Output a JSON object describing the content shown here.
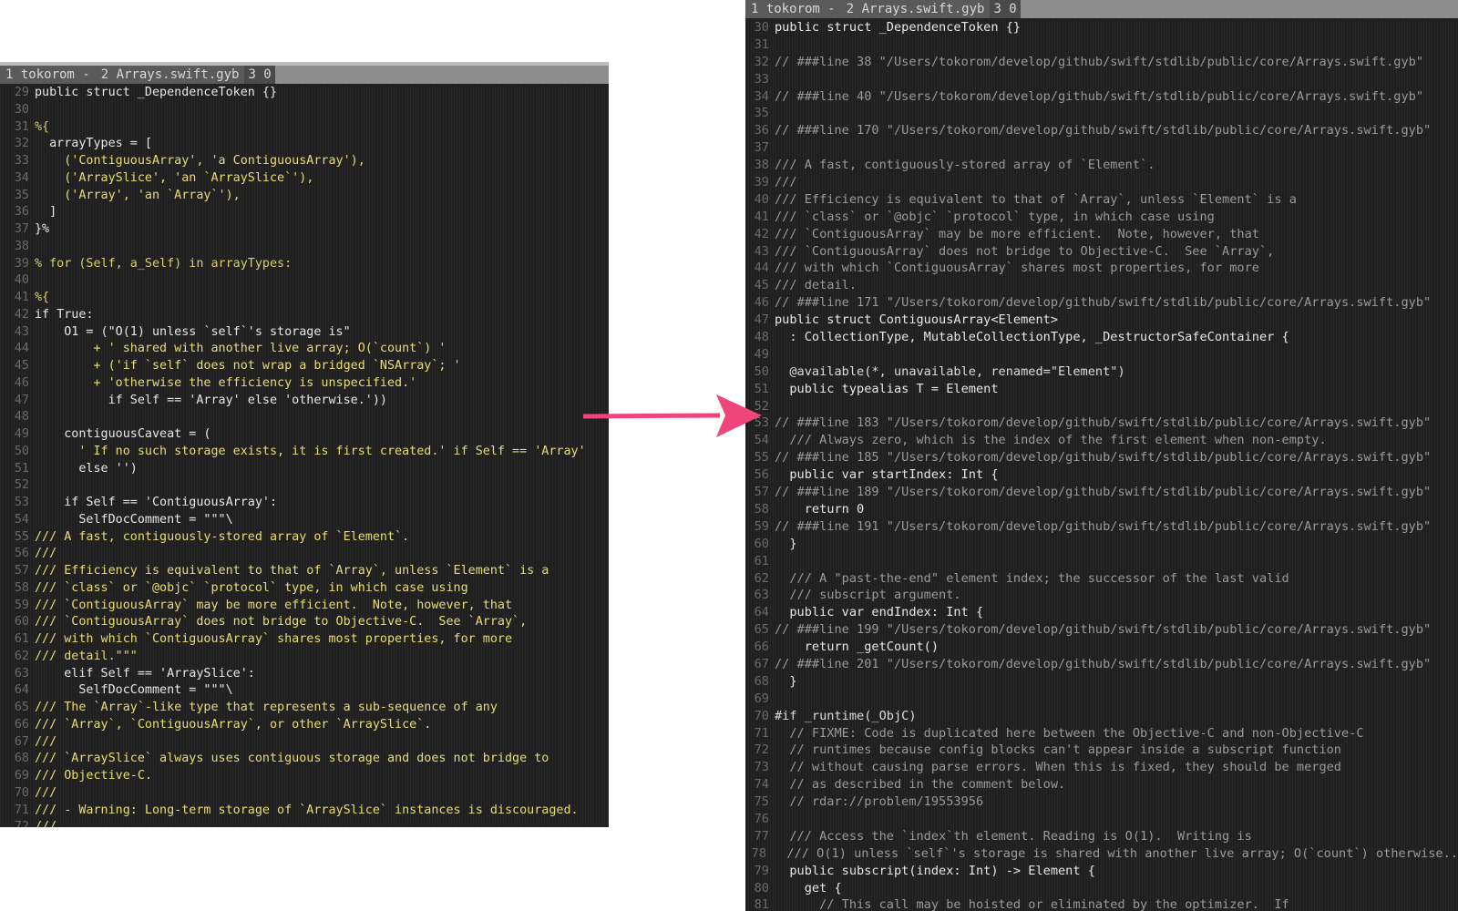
{
  "left_pane": {
    "tabs": [
      "1 tokorom -",
      "2 Arrays.swift.gyb",
      "3 0"
    ],
    "lines": [
      {
        "n": "29",
        "t": "public struct _DependenceToken {}"
      },
      {
        "n": "30",
        "t": ""
      },
      {
        "n": "31",
        "t": "%{"
      },
      {
        "n": "32",
        "t": "  arrayTypes = ["
      },
      {
        "n": "33",
        "t": "    ('ContiguousArray', 'a ContiguousArray'),"
      },
      {
        "n": "34",
        "t": "    ('ArraySlice', 'an `ArraySlice`'),"
      },
      {
        "n": "35",
        "t": "    ('Array', 'an `Array`'),"
      },
      {
        "n": "36",
        "t": "  ]"
      },
      {
        "n": "37",
        "t": "}%"
      },
      {
        "n": "38",
        "t": ""
      },
      {
        "n": "39",
        "t": "% for (Self, a_Self) in arrayTypes:"
      },
      {
        "n": "40",
        "t": ""
      },
      {
        "n": "41",
        "t": "%{"
      },
      {
        "n": "42",
        "t": "if True:"
      },
      {
        "n": "43",
        "t": "    O1 = (\"O(1) unless `self`'s storage is\""
      },
      {
        "n": "44",
        "t": "        + ' shared with another live array; O(`count`) '"
      },
      {
        "n": "45",
        "t": "        + ('if `self` does not wrap a bridged `NSArray`; '"
      },
      {
        "n": "46",
        "t": "        + 'otherwise the efficiency is unspecified.'"
      },
      {
        "n": "47",
        "t": "          if Self == 'Array' else 'otherwise.'))"
      },
      {
        "n": "48",
        "t": ""
      },
      {
        "n": "49",
        "t": "    contiguousCaveat = ("
      },
      {
        "n": "50",
        "t": "      ' If no such storage exists, it is first created.' if Self == 'Array'"
      },
      {
        "n": "51",
        "t": "      else '')"
      },
      {
        "n": "52",
        "t": ""
      },
      {
        "n": "53",
        "t": "    if Self == 'ContiguousArray':"
      },
      {
        "n": "54",
        "t": "      SelfDocComment = \"\"\"\\"
      },
      {
        "n": "55",
        "t": "/// A fast, contiguously-stored array of `Element`."
      },
      {
        "n": "56",
        "t": "///"
      },
      {
        "n": "57",
        "t": "/// Efficiency is equivalent to that of `Array`, unless `Element` is a"
      },
      {
        "n": "58",
        "t": "/// `class` or `@objc` `protocol` type, in which case using"
      },
      {
        "n": "59",
        "t": "/// `ContiguousArray` may be more efficient.  Note, however, that"
      },
      {
        "n": "60",
        "t": "/// `ContiguousArray` does not bridge to Objective-C.  See `Array`,"
      },
      {
        "n": "61",
        "t": "/// with which `ContiguousArray` shares most properties, for more"
      },
      {
        "n": "62",
        "t": "/// detail.\"\"\""
      },
      {
        "n": "63",
        "t": "    elif Self == 'ArraySlice':"
      },
      {
        "n": "64",
        "t": "      SelfDocComment = \"\"\"\\"
      },
      {
        "n": "65",
        "t": "/// The `Array`-like type that represents a sub-sequence of any"
      },
      {
        "n": "66",
        "t": "/// `Array`, `ContiguousArray`, or other `ArraySlice`."
      },
      {
        "n": "67",
        "t": "///"
      },
      {
        "n": "68",
        "t": "/// `ArraySlice` always uses contiguous storage and does not bridge to"
      },
      {
        "n": "69",
        "t": "/// Objective-C."
      },
      {
        "n": "70",
        "t": "///"
      },
      {
        "n": "71",
        "t": "/// - Warning: Long-term storage of `ArraySlice` instances is discouraged."
      },
      {
        "n": "72",
        "t": "///"
      }
    ]
  },
  "right_pane": {
    "tabs": [
      "1 tokorom -",
      "2 Arrays.swift.gyb",
      "3 0"
    ],
    "lines": [
      {
        "n": "30",
        "t": "public struct _DependenceToken {}"
      },
      {
        "n": "31",
        "t": ""
      },
      {
        "n": "32",
        "t": "// ###line 38 \"/Users/tokorom/develop/github/swift/stdlib/public/core/Arrays.swift.gyb\""
      },
      {
        "n": "33",
        "t": ""
      },
      {
        "n": "34",
        "t": "// ###line 40 \"/Users/tokorom/develop/github/swift/stdlib/public/core/Arrays.swift.gyb\""
      },
      {
        "n": "35",
        "t": ""
      },
      {
        "n": "36",
        "t": "// ###line 170 \"/Users/tokorom/develop/github/swift/stdlib/public/core/Arrays.swift.gyb\""
      },
      {
        "n": "37",
        "t": ""
      },
      {
        "n": "38",
        "t": "/// A fast, contiguously-stored array of `Element`."
      },
      {
        "n": "39",
        "t": "///"
      },
      {
        "n": "40",
        "t": "/// Efficiency is equivalent to that of `Array`, unless `Element` is a"
      },
      {
        "n": "41",
        "t": "/// `class` or `@objc` `protocol` type, in which case using"
      },
      {
        "n": "42",
        "t": "/// `ContiguousArray` may be more efficient.  Note, however, that"
      },
      {
        "n": "43",
        "t": "/// `ContiguousArray` does not bridge to Objective-C.  See `Array`,"
      },
      {
        "n": "44",
        "t": "/// with which `ContiguousArray` shares most properties, for more"
      },
      {
        "n": "45",
        "t": "/// detail."
      },
      {
        "n": "46",
        "t": "// ###line 171 \"/Users/tokorom/develop/github/swift/stdlib/public/core/Arrays.swift.gyb\""
      },
      {
        "n": "47",
        "t": "public struct ContiguousArray<Element>"
      },
      {
        "n": "48",
        "t": "  : CollectionType, MutableCollectionType, _DestructorSafeContainer {"
      },
      {
        "n": "49",
        "t": ""
      },
      {
        "n": "50",
        "t": "  @available(*, unavailable, renamed=\"Element\")"
      },
      {
        "n": "51",
        "t": "  public typealias T = Element"
      },
      {
        "n": "52",
        "t": ""
      },
      {
        "n": "53",
        "t": "// ###line 183 \"/Users/tokorom/develop/github/swift/stdlib/public/core/Arrays.swift.gyb\""
      },
      {
        "n": "54",
        "t": "  /// Always zero, which is the index of the first element when non-empty."
      },
      {
        "n": "55",
        "t": "// ###line 185 \"/Users/tokorom/develop/github/swift/stdlib/public/core/Arrays.swift.gyb\""
      },
      {
        "n": "56",
        "t": "  public var startIndex: Int {"
      },
      {
        "n": "57",
        "t": "// ###line 189 \"/Users/tokorom/develop/github/swift/stdlib/public/core/Arrays.swift.gyb\""
      },
      {
        "n": "58",
        "t": "    return 0"
      },
      {
        "n": "59",
        "t": "// ###line 191 \"/Users/tokorom/develop/github/swift/stdlib/public/core/Arrays.swift.gyb\""
      },
      {
        "n": "60",
        "t": "  }"
      },
      {
        "n": "61",
        "t": ""
      },
      {
        "n": "62",
        "t": "  /// A \"past-the-end\" element index; the successor of the last valid"
      },
      {
        "n": "63",
        "t": "  /// subscript argument."
      },
      {
        "n": "64",
        "t": "  public var endIndex: Int {"
      },
      {
        "n": "65",
        "t": "// ###line 199 \"/Users/tokorom/develop/github/swift/stdlib/public/core/Arrays.swift.gyb\""
      },
      {
        "n": "66",
        "t": "    return _getCount()"
      },
      {
        "n": "67",
        "t": "// ###line 201 \"/Users/tokorom/develop/github/swift/stdlib/public/core/Arrays.swift.gyb\""
      },
      {
        "n": "68",
        "t": "  }"
      },
      {
        "n": "69",
        "t": ""
      },
      {
        "n": "70",
        "t": "#if _runtime(_ObjC)"
      },
      {
        "n": "71",
        "t": "  // FIXME: Code is duplicated here between the Objective-C and non-Objective-C"
      },
      {
        "n": "72",
        "t": "  // runtimes because config blocks can't appear inside a subscript function"
      },
      {
        "n": "73",
        "t": "  // without causing parse errors. When this is fixed, they should be merged"
      },
      {
        "n": "74",
        "t": "  // as described in the comment below."
      },
      {
        "n": "75",
        "t": "  // rdar://problem/19553956"
      },
      {
        "n": "76",
        "t": ""
      },
      {
        "n": "77",
        "t": "  /// Access the `index`th element. Reading is O(1).  Writing is"
      },
      {
        "n": "78",
        "t": "  /// O(1) unless `self`'s storage is shared with another live array; O(`count`) otherwise.."
      },
      {
        "n": "79",
        "t": "  public subscript(index: Int) -> Element {"
      },
      {
        "n": "80",
        "t": "    get {"
      },
      {
        "n": "81",
        "t": "      // This call may be hoisted or eliminated by the optimizer.  If"
      }
    ]
  },
  "colors": {
    "editor_bg": "#1f1f1f",
    "arrow": "#f0457a"
  }
}
